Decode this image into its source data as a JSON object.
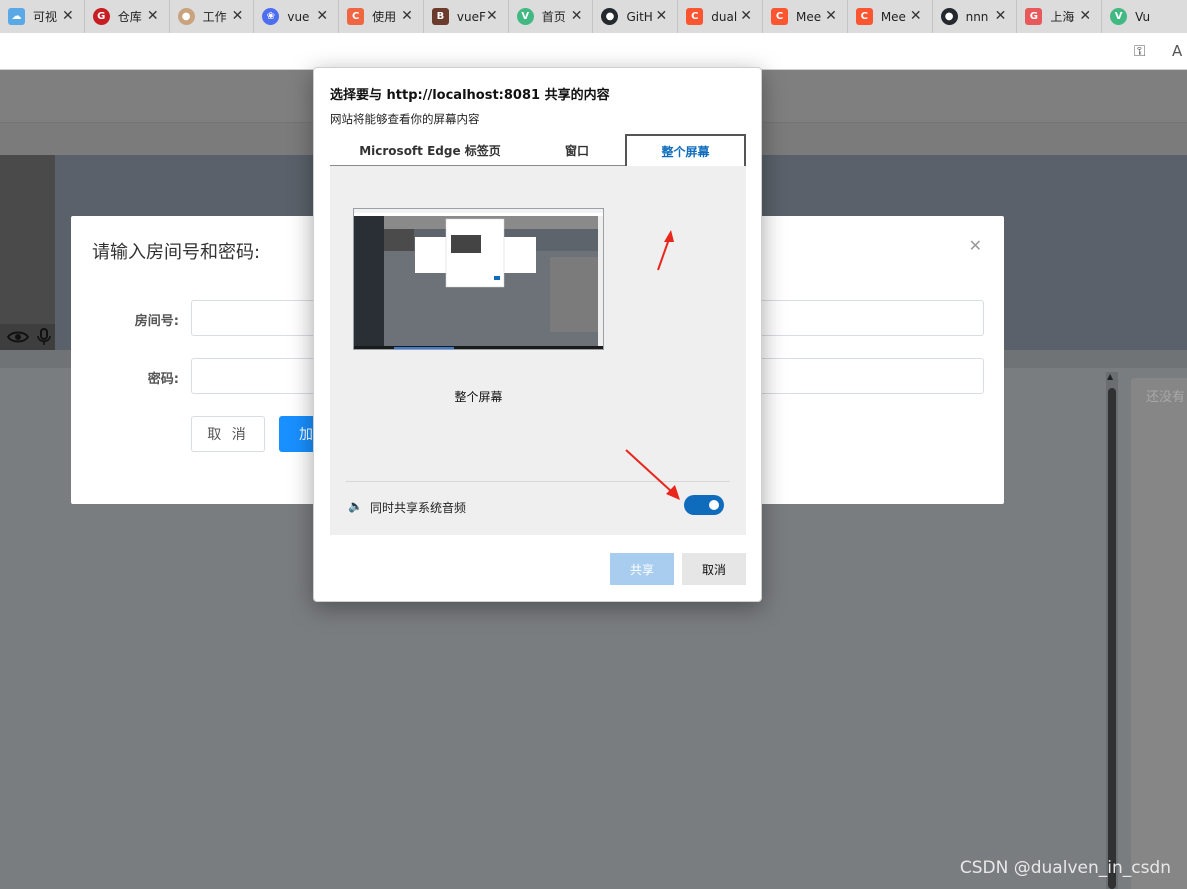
{
  "browser": {
    "tabs": [
      {
        "title": "可视",
        "favicon": "cloud-icon",
        "color": "#5aa9e6"
      },
      {
        "title": "仓库",
        "favicon": "gitee-icon",
        "color": "#c71d23"
      },
      {
        "title": "工作",
        "favicon": "avatar-icon",
        "color": "#c9a27e"
      },
      {
        "title": "vue",
        "favicon": "paw-icon",
        "color": "#4e6ef2"
      },
      {
        "title": "使用",
        "favicon": "c-icon",
        "color": "#f06542"
      },
      {
        "title": "vueF",
        "favicon": "b-icon",
        "color": "#6b3b2e"
      },
      {
        "title": "首页",
        "favicon": "vue-icon",
        "color": "#42b883"
      },
      {
        "title": "GitH",
        "favicon": "github-icon",
        "color": "#24292f"
      },
      {
        "title": "dual",
        "favicon": "csdn-icon",
        "color": "#fc5531"
      },
      {
        "title": "Mee",
        "favicon": "csdn-icon",
        "color": "#fc5531"
      },
      {
        "title": "Mee",
        "favicon": "csdn-icon",
        "color": "#fc5531"
      },
      {
        "title": "nnn",
        "favicon": "github-icon",
        "color": "#24292f"
      },
      {
        "title": "上海",
        "favicon": "gb-icon",
        "color": "#e8595b"
      },
      {
        "title": "Vu",
        "favicon": "vue-icon",
        "color": "#42b883"
      }
    ]
  },
  "room_dialog": {
    "title": "请输入房间号和密码:",
    "room_label": "房间号:",
    "password_label": "密码:",
    "cancel_label": "取 消",
    "join_label": "加"
  },
  "side_panel": {
    "placeholder": "还没有"
  },
  "share_dialog": {
    "title": "选择要与 http://localhost:8081 共享的内容",
    "subtitle": "网站将能够查看你的屏幕内容",
    "tabs": [
      {
        "label": "Microsoft Edge 标签页",
        "active": false
      },
      {
        "label": "窗口",
        "active": false
      },
      {
        "label": "整个屏幕",
        "active": true
      }
    ],
    "screen_caption": "整个屏幕",
    "audio_label": "同时共享系统音频",
    "audio_enabled": true,
    "share_label": "共享",
    "cancel_label": "取消"
  },
  "watermark": "CSDN @dualven_in_csdn",
  "colors": {
    "accent": "#0f6cbd",
    "primary_button": "#1890ff",
    "annotation_arrow": "#e8261c"
  }
}
